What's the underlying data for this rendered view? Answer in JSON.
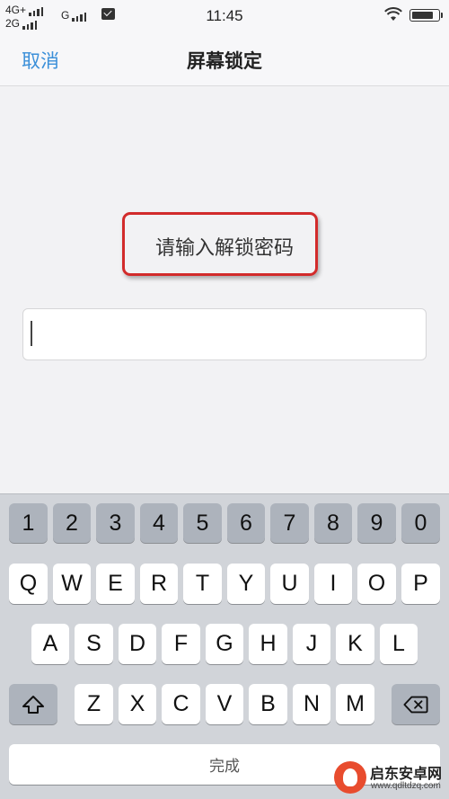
{
  "status_bar": {
    "network_1": "4G+",
    "network_2": "2G",
    "network_3": "G",
    "time": "11:45",
    "icons": [
      "signal-icon",
      "mail-icon",
      "wifi-icon",
      "battery-icon"
    ],
    "battery_level": 0.85
  },
  "nav": {
    "cancel_label": "取消",
    "title": "屏幕锁定"
  },
  "prompt": {
    "text": "请输入解锁密码",
    "highlight_color": "#d22b2b"
  },
  "password_field": {
    "value": "",
    "placeholder": ""
  },
  "keyboard": {
    "number_row": [
      "1",
      "2",
      "3",
      "4",
      "5",
      "6",
      "7",
      "8",
      "9",
      "0"
    ],
    "row_1": [
      "Q",
      "W",
      "E",
      "R",
      "T",
      "Y",
      "U",
      "I",
      "O",
      "P"
    ],
    "row_2": [
      "A",
      "S",
      "D",
      "F",
      "G",
      "H",
      "J",
      "K",
      "L"
    ],
    "row_3": [
      "Z",
      "X",
      "C",
      "V",
      "B",
      "N",
      "M"
    ],
    "shift_icon": "shift-icon",
    "backspace_icon": "backspace-icon",
    "done_label": "完成"
  },
  "watermark": {
    "name": "启东安卓网",
    "url": "www.qdltdzq.com"
  },
  "colors": {
    "accent": "#3a8fd9",
    "keyboard_bg": "#d1d4d9",
    "key_bg": "#ffffff",
    "key_gray": "#adb3bc"
  }
}
